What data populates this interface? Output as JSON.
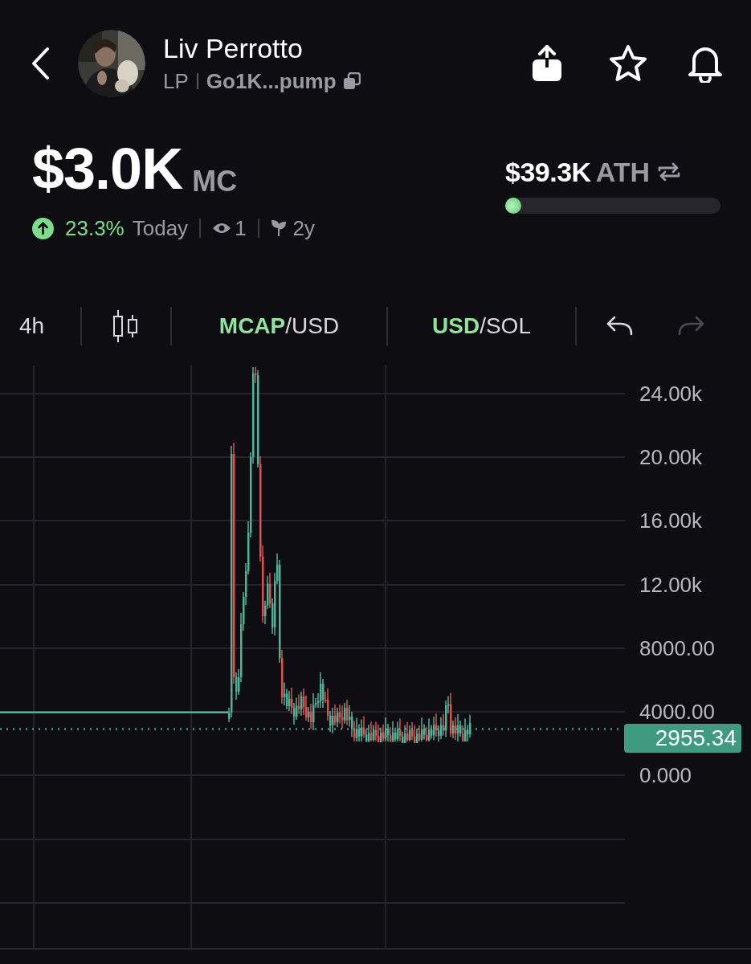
{
  "header": {
    "name": "Liv Perrotto",
    "symbol": "LP",
    "address": "Go1K...pump"
  },
  "market_cap": {
    "value": "$3.0K",
    "unit": "MC",
    "change": "23.3%",
    "rising": true,
    "period": "Today",
    "watchers": "1",
    "age": "2y"
  },
  "ath": {
    "value": "$39.3K",
    "label": "ATH",
    "level": 0.075
  },
  "toolbar": {
    "interval": "4h",
    "toggles": [
      {
        "separator": "/",
        "options": [
          {
            "label": "MCAP",
            "selected": true
          },
          {
            "label": "USD",
            "selected": false
          }
        ]
      },
      {
        "separator": "/",
        "options": [
          {
            "label": "USD",
            "selected": true
          },
          {
            "label": "SOL",
            "selected": false
          }
        ]
      }
    ],
    "undo": {
      "disabled": false
    },
    "redo": {
      "disabled": true
    }
  },
  "chart": {
    "axis_labels": [
      "24.00k",
      "20.00k",
      "16.00k",
      "12.00k",
      "8000.00",
      "4000.00",
      "0.000"
    ],
    "price_tag": "2955.34"
  }
}
